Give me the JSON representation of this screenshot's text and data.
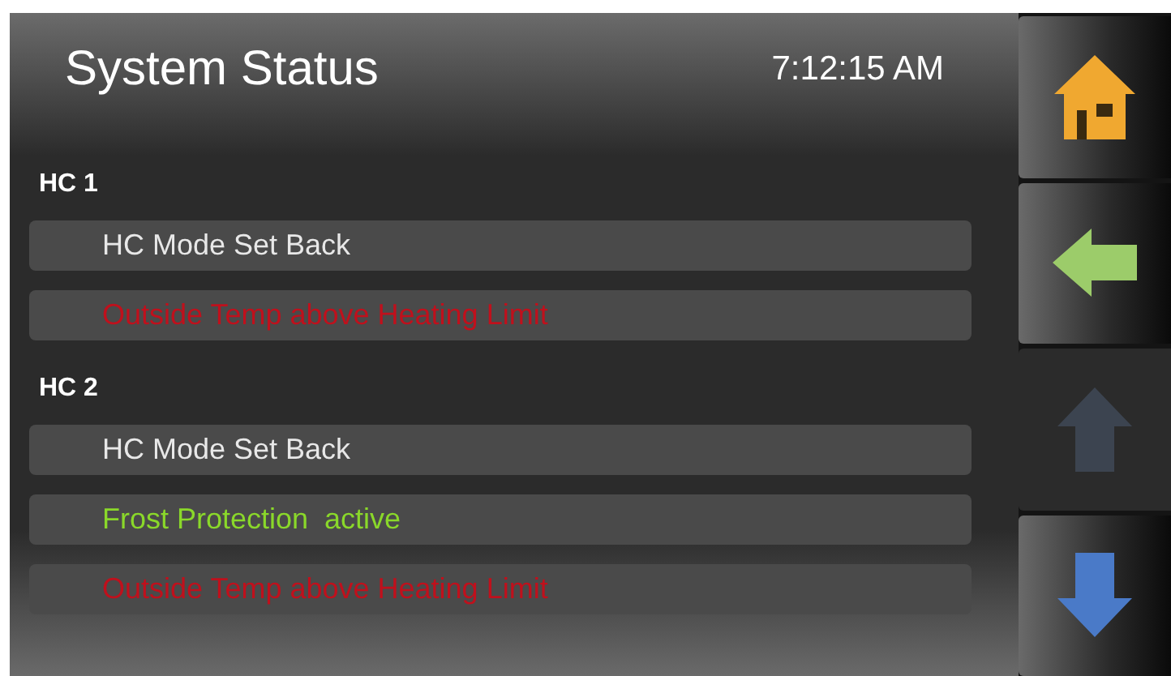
{
  "header": {
    "title": "System Status",
    "time": "7:12:15 AM"
  },
  "groups": [
    {
      "label": "HC 1",
      "messages": [
        {
          "text": "HC Mode Set Back",
          "color": "#e8e8e8"
        },
        {
          "text": "Outside Temp above Heating Limit",
          "color": "#c0101c"
        }
      ]
    },
    {
      "label": "HC 2",
      "messages": [
        {
          "text": "HC Mode Set Back",
          "color": "#e8e8e8"
        },
        {
          "text": "Frost Protection  active",
          "color": "#8ad82a"
        },
        {
          "text": "Outside Temp above Heating Limit",
          "color": "#c0101c"
        }
      ]
    }
  ],
  "nav": [
    {
      "kind": "home",
      "disabled": false
    },
    {
      "kind": "back",
      "disabled": false
    },
    {
      "kind": "up",
      "disabled": true
    },
    {
      "kind": "down",
      "disabled": false
    }
  ]
}
